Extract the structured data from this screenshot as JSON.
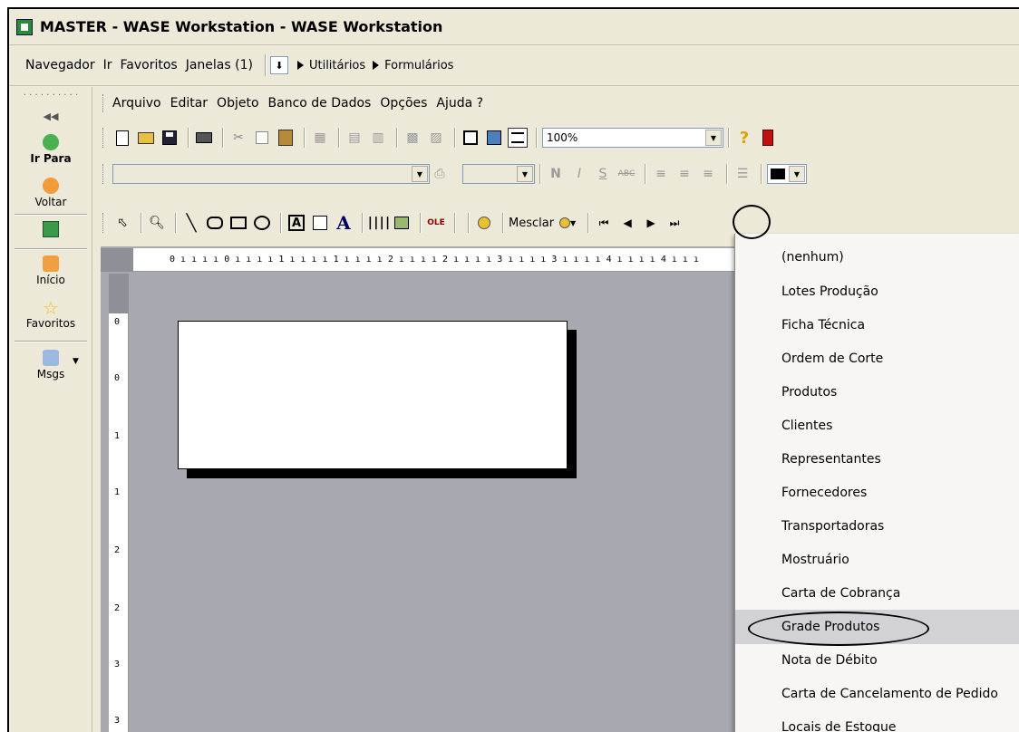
{
  "window": {
    "title": "MASTER - WASE Workstation - WASE Workstation"
  },
  "nav": {
    "menus": [
      "Navegador",
      "Ir",
      "Favoritos",
      "Janelas (1)"
    ],
    "breadcrumb": [
      "Utilitários",
      "Formulários"
    ]
  },
  "sidebar": {
    "items": [
      {
        "label": "Ir Para",
        "icon": "go-arrow-icon"
      },
      {
        "label": "Voltar",
        "icon": "back-arrow-icon"
      },
      {
        "label": "Início",
        "icon": "home-icon"
      },
      {
        "label": "Favoritos",
        "icon": "star-icon"
      },
      {
        "label": "Msgs",
        "icon": "messages-icon"
      }
    ]
  },
  "menubar": {
    "items": [
      "Arquivo",
      "Editar",
      "Objeto",
      "Banco de Dados",
      "Opções",
      "Ajuda ?"
    ]
  },
  "toolbar": {
    "zoom": "100%",
    "merge_label": "Mesclar"
  },
  "ruler": {
    "horizontal_text": "0 ı ı ı ı 0 ı ı ı ı 1 ı ı ı ı 1 ı ı ı ı 2 ı ı ı ı 2 ı ı ı ı 3 ı ı ı ı 3 ı ı ı ı 4 ı ı ı ı 4 ı ı ı",
    "vertical_numbers": [
      "0",
      "0",
      "1",
      "1",
      "2",
      "2",
      "3",
      "3"
    ]
  },
  "dropdown": {
    "items": [
      "(nenhum)",
      "Lotes Produção",
      "Ficha Técnica",
      "Ordem de Corte",
      "Produtos",
      "Clientes",
      "Representantes",
      "Fornecedores",
      "Transportadoras",
      "Mostruário",
      "Carta de Cobrança",
      "Grade Produtos",
      "Nota de Débito",
      "Carta de Cancelamento de Pedido",
      "Locais de Estoque"
    ],
    "highlighted": "Grade Produtos"
  },
  "colors": {
    "canvas": "#a8a8b0",
    "chrome": "#ece9d8",
    "highlight": "#d2d2d6"
  }
}
